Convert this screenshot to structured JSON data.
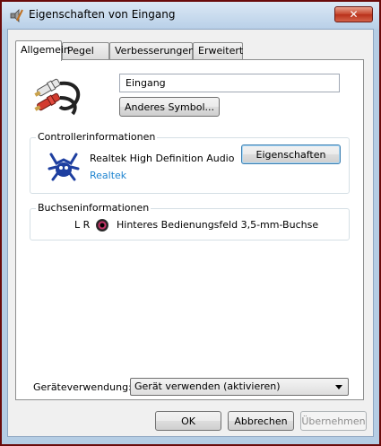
{
  "window": {
    "title": "Eigenschaften von Eingang",
    "close_label": "✕"
  },
  "tabs": [
    {
      "label": "Allgemein",
      "active": true
    },
    {
      "label": "Pegel",
      "active": false
    },
    {
      "label": "Verbesserungen",
      "active": false
    },
    {
      "label": "Erweitert",
      "active": false
    }
  ],
  "general": {
    "device_name_value": "Eingang",
    "change_icon_label": "Anderes Symbol..."
  },
  "controller": {
    "group_label": "Controllerinformationen",
    "name": "Realtek High Definition Audio",
    "vendor_link": "Realtek",
    "properties_label": "Eigenschaften"
  },
  "jack": {
    "group_label": "Buchseninformationen",
    "channels": "L R",
    "description": "Hinteres Bedienungsfeld 3,5-mm-Buchse",
    "jack_color": "#c8356a"
  },
  "usage": {
    "label": "Geräteverwendung:",
    "selected": "Gerät verwenden (aktivieren)"
  },
  "footer": {
    "ok_label": "OK",
    "cancel_label": "Abbrechen",
    "apply_label": "Übernehmen"
  }
}
